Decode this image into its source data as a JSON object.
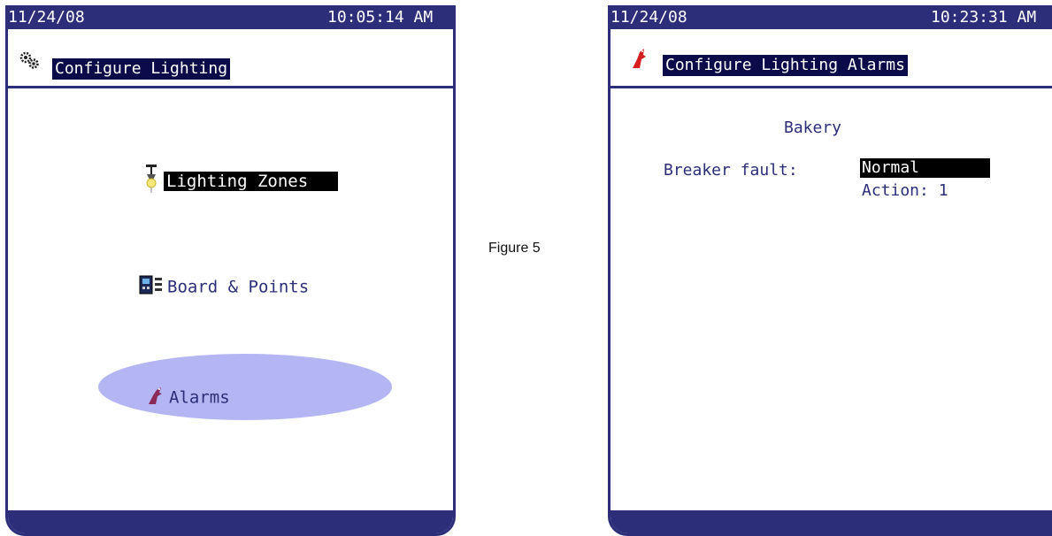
{
  "caption": "Figure 5",
  "left_screen": {
    "date": "11/24/08",
    "time": "10:05:14 AM",
    "title": "Configure Lighting",
    "title_icon": "gears-icon",
    "menu": [
      {
        "label": "Lighting Zones",
        "icon": "lamp-icon",
        "selected": true
      },
      {
        "label": "Board & Points",
        "icon": "board-icon",
        "selected": false
      },
      {
        "label": "Alarms",
        "icon": "bird-alarm-icon",
        "selected": false,
        "highlighted": true
      }
    ]
  },
  "right_screen": {
    "date": "11/24/08",
    "time": "10:23:31 AM",
    "title": "Configure Lighting Alarms",
    "title_icon": "bird-alarm-icon",
    "zone_name": "Bakery",
    "field_label": "Breaker fault:",
    "field_value": "Normal",
    "field_action": "Action: 1"
  },
  "colors": {
    "frame": "#2c2e7a",
    "highlight": "#b4b6f4",
    "title_bg": "#0b0b4a"
  }
}
